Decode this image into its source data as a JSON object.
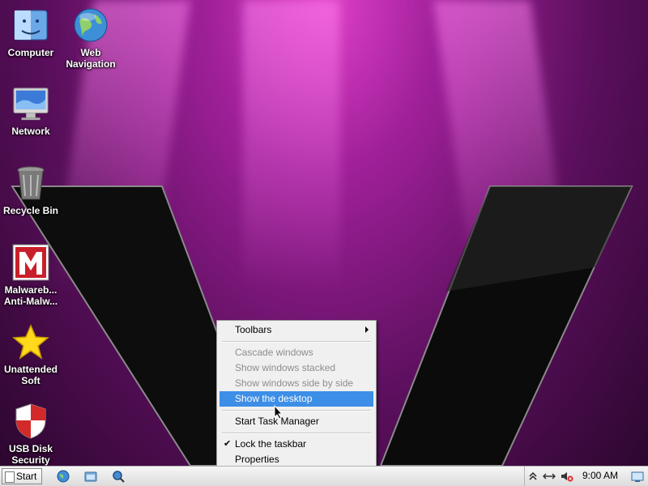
{
  "desktop": {
    "icons": [
      {
        "label": "Computer",
        "icon": "finder-computer-icon"
      },
      {
        "label": "Web\nNavigation",
        "icon": "globe-icon"
      },
      {
        "label": "Network",
        "icon": "monitor-icon"
      },
      {
        "label": "Recycle Bin",
        "icon": "trash-icon"
      },
      {
        "label": "Malwareb...\nAnti-Malw...",
        "icon": "malwarebytes-icon"
      },
      {
        "label": "Unattended\nSoft",
        "icon": "star-icon"
      },
      {
        "label": "USB Disk\nSecurity",
        "icon": "shield-icon"
      }
    ]
  },
  "context_menu": {
    "items": [
      {
        "label": "Toolbars",
        "enabled": true,
        "submenu": true
      },
      {
        "label": "Cascade windows",
        "enabled": false
      },
      {
        "label": "Show windows stacked",
        "enabled": false
      },
      {
        "label": "Show windows side by side",
        "enabled": false
      },
      {
        "label": "Show the desktop",
        "enabled": true,
        "highlighted": true
      },
      {
        "label": "Start Task Manager",
        "enabled": true
      },
      {
        "label": "Lock the taskbar",
        "enabled": true,
        "checked": true
      },
      {
        "label": "Properties",
        "enabled": true
      }
    ],
    "check_mark": "✔"
  },
  "taskbar": {
    "start_label": "Start",
    "quick_launch": [
      "globe-icon",
      "folder-icon",
      "search-icon"
    ],
    "tray": {
      "icons": [
        "chevron-up-icon",
        "network-icon",
        "volume-muted-icon"
      ],
      "clock": "9:00 AM"
    }
  },
  "colors": {
    "menu_highlight": "#3d8ee6",
    "desktop_bg": "#7a1676"
  }
}
